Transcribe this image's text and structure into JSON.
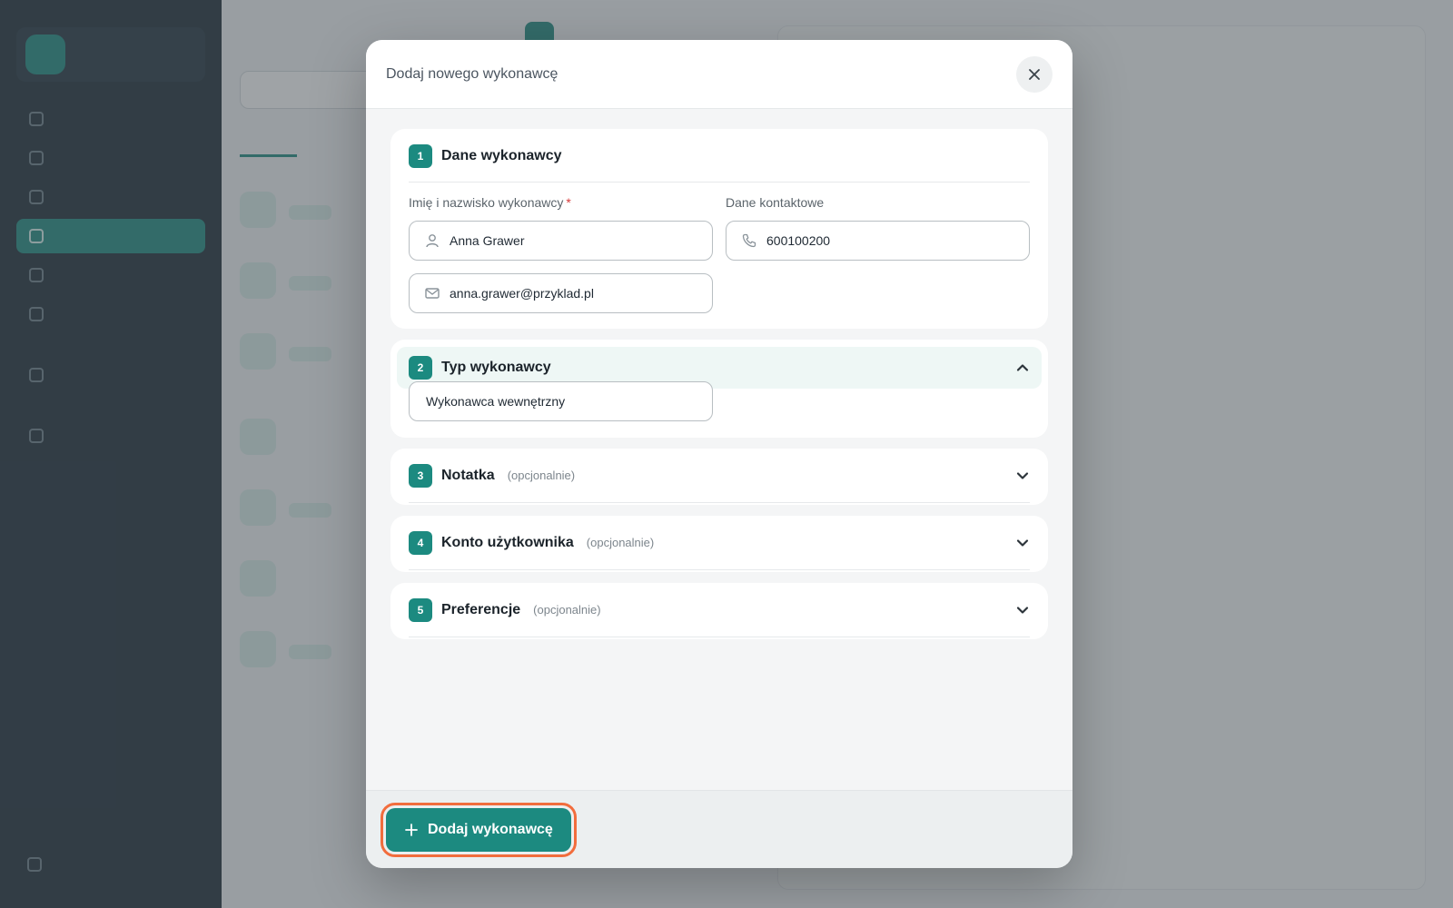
{
  "modal": {
    "title": "Dodaj nowego wykonawcę",
    "sections": [
      {
        "step": "1",
        "title": "Dane wykonawcy",
        "name_label": "Imię i nazwisko wykonawcy",
        "required_mark": "*",
        "name_value": "Anna Grawer",
        "contact_label": "Dane kontaktowe",
        "phone_value": "600100200",
        "email_value": "anna.grawer@przyklad.pl"
      },
      {
        "step": "2",
        "title": "Typ wykonawcy",
        "selected": "Wykonawca wewnętrzny"
      },
      {
        "step": "3",
        "title": "Notatka",
        "optional": "(opcjonalnie)"
      },
      {
        "step": "4",
        "title": "Konto użytkownika",
        "optional": "(opcjonalnie)"
      },
      {
        "step": "5",
        "title": "Preferencje",
        "optional": "(opcjonalnie)"
      }
    ],
    "submit_label": "Dodaj wykonawcę"
  },
  "colors": {
    "accent": "#1c8a80",
    "focus_ring": "#f26d3d",
    "required": "#d63b3b"
  },
  "icons": {
    "close": "close-icon",
    "user": "user-icon",
    "phone": "phone-icon",
    "mail": "mail-icon",
    "chevron_up": "chevron-up-icon",
    "chevron_down": "chevron-down-icon",
    "plus": "plus-icon"
  }
}
